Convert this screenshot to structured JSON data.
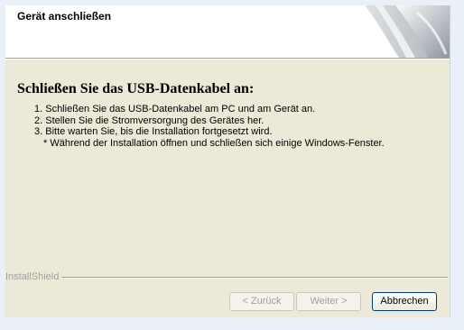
{
  "header": {
    "title": "Gerät anschließen"
  },
  "main": {
    "heading": "Schließen Sie das USB-Datenkabel an:",
    "steps": [
      "1. Schließen Sie das USB-Datenkabel am PC und am Gerät an.",
      "2. Stellen Sie die Stromversorgung des Gerätes her.",
      "3. Bitte warten Sie, bis die Installation fortgesetzt wird."
    ],
    "note": "* Während der Installation öffnen und schließen sich einige Windows-Fenster."
  },
  "footer": {
    "brand": "InstallShield",
    "buttons": {
      "back": "< Zurück",
      "next": "Weiter >",
      "cancel": "Abbrechen"
    }
  },
  "colors": {
    "dialog_background": "#ece9d8",
    "header_background": "#ffffff",
    "default_button_border": "#003c74",
    "disabled_text": "#a1a192"
  },
  "icons": {
    "header_art": "page-curl-graphic"
  }
}
